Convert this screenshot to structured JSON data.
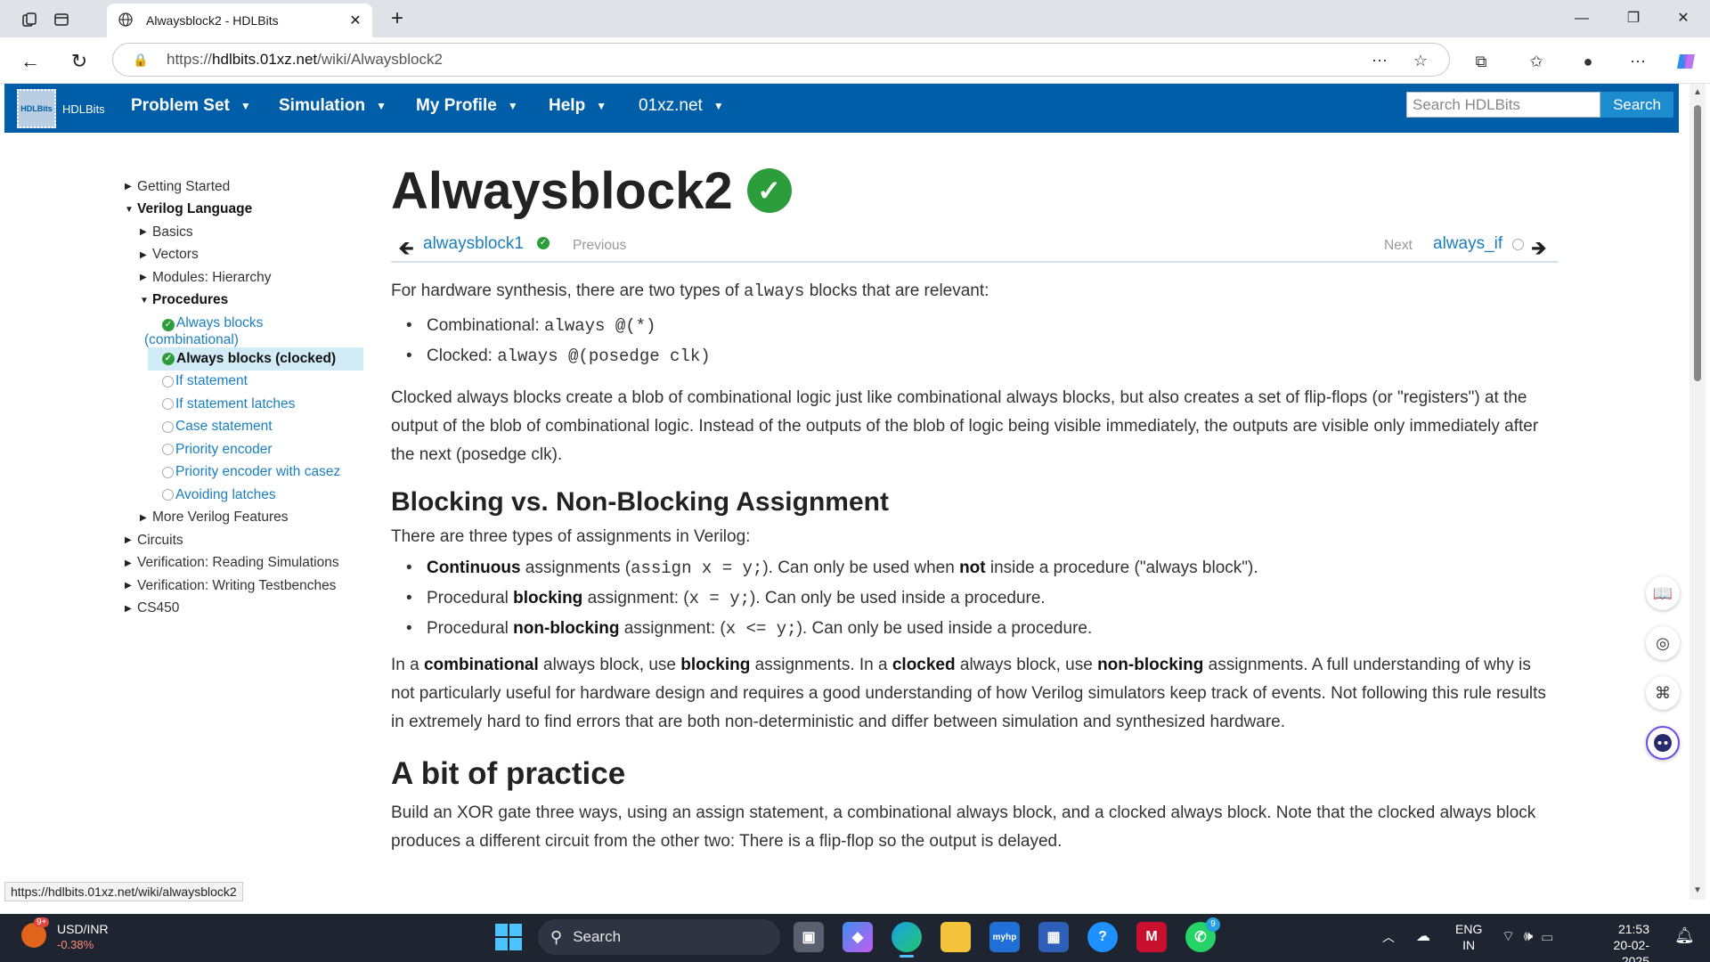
{
  "browser": {
    "tab_title": "Alwaysblock2 - HDLBits",
    "url_prefix": "https://",
    "url_domain": "hdlbits.01xz.net",
    "url_path": "/wiki/Alwaysblock2",
    "status_url": "https://hdlbits.01xz.net/wiki/alwaysblock2"
  },
  "site": {
    "logo_text": "HDLBits",
    "name": "HDLBits",
    "menu": [
      "Problem Set",
      "Simulation",
      "My Profile",
      "Help",
      "01xz.net"
    ],
    "search_placeholder": "Search HDLBits",
    "search_button": "Search"
  },
  "sidebar": {
    "items": [
      {
        "label": "Getting Started"
      },
      {
        "label": "Verilog Language"
      },
      {
        "label": "Basics"
      },
      {
        "label": "Vectors"
      },
      {
        "label": "Modules: Hierarchy"
      },
      {
        "label": "Procedures"
      },
      {
        "label": "Always blocks (combinational)"
      },
      {
        "label": "Always blocks (clocked)"
      },
      {
        "label": "If statement"
      },
      {
        "label": "If statement latches"
      },
      {
        "label": "Case statement"
      },
      {
        "label": "Priority encoder"
      },
      {
        "label": "Priority encoder with casez"
      },
      {
        "label": "Avoiding latches"
      },
      {
        "label": "More Verilog Features"
      },
      {
        "label": "Circuits"
      },
      {
        "label": "Verification: Reading Simulations"
      },
      {
        "label": "Verification: Writing Testbenches"
      },
      {
        "label": "CS450"
      }
    ]
  },
  "main": {
    "title": "Alwaysblock2",
    "prev_link": "alwaysblock1",
    "prev_label": "Previous",
    "next_label": "Next",
    "next_link": "always_if",
    "intro_a": "For hardware synthesis, there are two types of ",
    "intro_code": "always",
    "intro_b": " blocks that are relevant:",
    "types": [
      {
        "label": "Combinational: ",
        "code": "always @(*)"
      },
      {
        "label": "Clocked: ",
        "code": "always @(posedge clk)"
      }
    ],
    "clocked_para": "Clocked always blocks create a blob of combinational logic just like combinational always blocks, but also creates a set of flip-flops (or \"registers\") at the output of the blob of combinational logic. Instead of the outputs of the blob of logic being visible immediately, the outputs are visible only immediately after the next (posedge clk).",
    "h_blocking": "Blocking vs. Non-Blocking Assignment",
    "three_types": "There are three types of assignments in Verilog:",
    "assign_items": [
      {
        "pre": "",
        "bold": "Continuous",
        "mid": " assignments (",
        "code": "assign x = y;",
        "post": "). Can only be used when ",
        "bold2": "not",
        "post2": " inside a procedure (\"always block\")."
      },
      {
        "pre": "Procedural ",
        "bold": "blocking",
        "mid": " assignment: (",
        "code": "x = y;",
        "post": "). Can only be used inside a procedure.",
        "bold2": "",
        "post2": ""
      },
      {
        "pre": "Procedural ",
        "bold": "non-blocking",
        "mid": " assignment: (",
        "code": "x <= y;",
        "post": "). Can only be used inside a procedure.",
        "bold2": "",
        "post2": ""
      }
    ],
    "usage": {
      "t1": "In a ",
      "b1": "combinational",
      "t2": " always block, use ",
      "b2": "blocking",
      "t3": " assignments. In a ",
      "b3": "clocked",
      "t4": " always block, use ",
      "b4": "non-blocking",
      "t5": " assignments. A full understanding of why is not particularly useful for hardware design and requires a good understanding of how Verilog simulators keep track of events. Not following this rule results in extremely hard to find errors that are both non-deterministic and differ between simulation and synthesized hardware."
    },
    "h_practice": "A bit of practice",
    "practice_para": "Build an XOR gate three ways, using an assign statement, a combinational always block, and a clocked always block. Note that the clocked always block produces a different circuit from the other two: There is a flip-flop so the output is delayed."
  },
  "taskbar": {
    "ticker_badge": "9+",
    "ticker_name": "USD/INR",
    "ticker_value": "-0.38%",
    "search_label": "Search",
    "whatsapp_badge": "9",
    "lang_top": "ENG",
    "lang_bottom": "IN",
    "time": "21:53",
    "date": "20-02-2025"
  }
}
